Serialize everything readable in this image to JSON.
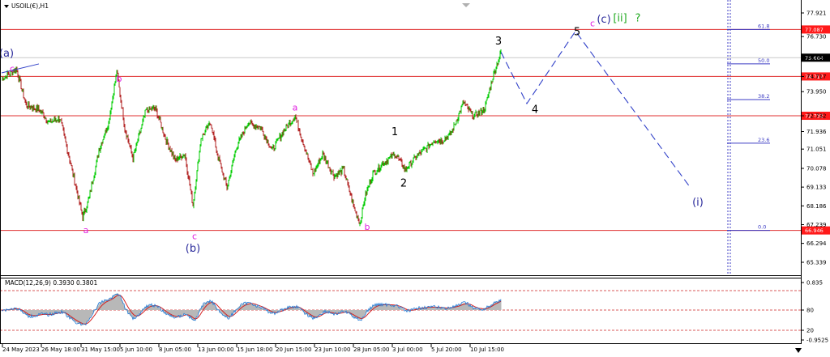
{
  "window": {
    "symbol_label": "USOIL(€),H1",
    "macd_label": "MACD(12,26,9) 0.3930 0.3801"
  },
  "colors": {
    "bull": "#00cc00",
    "bear": "#b22222",
    "level_line": "#e03030",
    "price_tag": "#ff1a1a",
    "current_tag": "#000000",
    "fib": "#3b3bc4",
    "projection": "#3040c8",
    "magenta": "#e020e0",
    "navy": "#2c2c9c",
    "green_label": "#22aa22",
    "macd_hist": "#b8b8b8",
    "macd_signal": "#d42020",
    "macd_line": "#1e7ad8"
  },
  "chart_data": {
    "type": "candlestick",
    "symbol": "USOIL(€),H1",
    "ylim": [
      65.339,
      77.921
    ],
    "y_ticks": [
      "77.921",
      "76.730",
      "75.664",
      "74.717",
      "73.950",
      "72.732",
      "71.936",
      "71.051",
      "70.078",
      "69.133",
      "68.186",
      "67.239",
      "66.294",
      "65.339"
    ],
    "x_ticks": [
      "24 May 2023",
      "26 May 18:00",
      "31 May 15:00",
      "5 Jun 10:00",
      "8 Jun 05:00",
      "13 Jun 00:00",
      "15 Jun 18:00",
      "20 Jun 15:00",
      "23 Jun 10:00",
      "28 Jun 05:00",
      "3 Jul 00:00",
      "5 Jul 20:00",
      "10 Jul 15:00"
    ],
    "price_path": [
      [
        0,
        74.6
      ],
      [
        18,
        75.1
      ],
      [
        30,
        73.3
      ],
      [
        48,
        73.0
      ],
      [
        58,
        72.4
      ],
      [
        72,
        72.6
      ],
      [
        88,
        69.8
      ],
      [
        100,
        67.6
      ],
      [
        108,
        68.6
      ],
      [
        120,
        71.0
      ],
      [
        132,
        72.4
      ],
      [
        142,
        75.0
      ],
      [
        152,
        72.1
      ],
      [
        162,
        70.6
      ],
      [
        178,
        73.0
      ],
      [
        190,
        73.1
      ],
      [
        202,
        71.6
      ],
      [
        214,
        70.5
      ],
      [
        226,
        70.8
      ],
      [
        236,
        68.2
      ],
      [
        246,
        71.6
      ],
      [
        258,
        72.4
      ],
      [
        266,
        70.8
      ],
      [
        278,
        69.1
      ],
      [
        290,
        71.2
      ],
      [
        304,
        72.4
      ],
      [
        320,
        72.1
      ],
      [
        334,
        71.0
      ],
      [
        348,
        72.0
      ],
      [
        362,
        72.7
      ],
      [
        372,
        71.4
      ],
      [
        384,
        69.8
      ],
      [
        396,
        70.8
      ],
      [
        410,
        69.7
      ],
      [
        422,
        70.0
      ],
      [
        434,
        68.2
      ],
      [
        442,
        67.3
      ],
      [
        448,
        68.6
      ],
      [
        458,
        69.8
      ],
      [
        472,
        70.4
      ],
      [
        486,
        70.8
      ],
      [
        498,
        70.0
      ],
      [
        512,
        70.7
      ],
      [
        524,
        71.1
      ],
      [
        534,
        71.5
      ],
      [
        544,
        71.5
      ],
      [
        554,
        71.8
      ],
      [
        560,
        72.4
      ],
      [
        570,
        73.4
      ],
      [
        582,
        72.7
      ],
      [
        596,
        73.1
      ],
      [
        606,
        74.7
      ],
      [
        616,
        75.95
      ]
    ],
    "levels": [
      {
        "price": 77.087,
        "label": "77.087"
      },
      {
        "price": 74.717,
        "label": "74.717"
      },
      {
        "price": 72.732,
        "label": "72.732"
      },
      {
        "price": 66.946,
        "label": "66.946"
      }
    ],
    "current_price": {
      "price": 75.664,
      "label": "75.664"
    },
    "fib_levels": [
      {
        "ratio": "61.8",
        "price": 77.087
      },
      {
        "ratio": "50.0",
        "price": 75.35
      },
      {
        "ratio": "38.2",
        "price": 73.55
      },
      {
        "ratio": "23.6",
        "price": 71.35
      },
      {
        "ratio": "0.0",
        "price": 66.946
      }
    ],
    "projection_path": [
      {
        "bar": 616,
        "price": 75.95
      },
      {
        "bar": 648,
        "price": 73.35
      },
      {
        "bar": 708,
        "price": 77.0
      },
      {
        "bar": 848,
        "price": 69.2
      }
    ],
    "wave_labels": [
      {
        "text": "(a)",
        "bar": 6,
        "price": 75.72,
        "color": "navy",
        "size": 13
      },
      {
        "text": "c",
        "bar": 13,
        "price": 74.95,
        "color": "magenta",
        "size": 11
      },
      {
        "text": "b",
        "bar": 145,
        "price": 74.45,
        "color": "magenta",
        "size": 11
      },
      {
        "text": "a",
        "bar": 104,
        "price": 66.8,
        "color": "magenta",
        "size": 11
      },
      {
        "text": "c",
        "bar": 238,
        "price": 66.5,
        "color": "magenta",
        "size": 11
      },
      {
        "text": "(b)",
        "bar": 236,
        "price": 65.87,
        "color": "navy",
        "size": 13
      },
      {
        "text": "a",
        "bar": 362,
        "price": 73.0,
        "color": "magenta",
        "size": 11
      },
      {
        "text": "b",
        "bar": 451,
        "price": 66.97,
        "color": "magenta",
        "size": 11
      },
      {
        "text": "1",
        "bar": 485,
        "price": 71.75,
        "color": "black",
        "size": 13
      },
      {
        "text": "2",
        "bar": 496,
        "price": 69.15,
        "color": "black",
        "size": 13
      },
      {
        "text": "3",
        "bar": 613,
        "price": 76.32,
        "color": "black",
        "size": 13
      },
      {
        "text": "4",
        "bar": 658,
        "price": 72.88,
        "color": "black",
        "size": 13
      },
      {
        "text": "5",
        "bar": 710,
        "price": 76.8,
        "color": "black",
        "size": 13
      },
      {
        "text": "c",
        "bar": 729,
        "price": 77.25,
        "color": "magenta",
        "size": 11
      },
      {
        "text": "(c)",
        "bar": 743,
        "price": 77.43,
        "color": "navy",
        "size": 13
      },
      {
        "text": "[ii]",
        "bar": 763,
        "price": 77.5,
        "color": "green_label",
        "size": 13
      },
      {
        "text": "?",
        "bar": 785,
        "price": 77.5,
        "color": "green_label",
        "size": 13
      },
      {
        "text": "(i)",
        "bar": 859,
        "price": 68.2,
        "color": "navy",
        "size": 13
      }
    ],
    "macd": {
      "label": "MACD(12,26,9) 0.3930 0.3801",
      "ylim": [
        -0.9525,
        0.835
      ],
      "y_ticks": [
        "0.835",
        "80",
        "20",
        "-0.9525"
      ],
      "dashed_levels": [
        80,
        20
      ]
    }
  }
}
